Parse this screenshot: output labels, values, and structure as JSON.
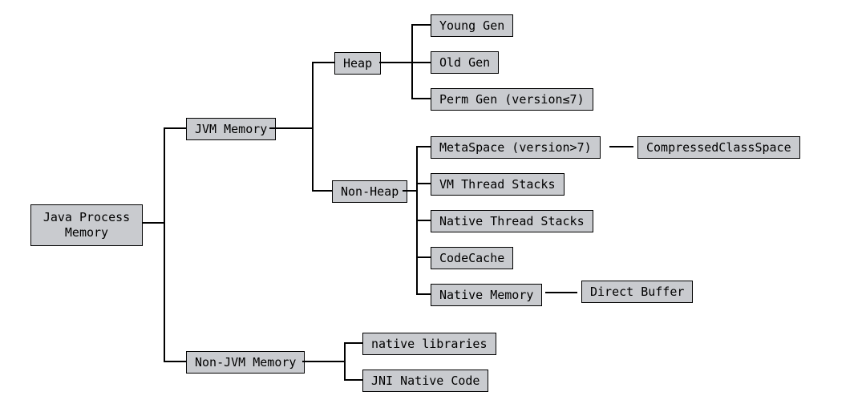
{
  "root": {
    "label": "Java Process\nMemory"
  },
  "l1": {
    "jvm": {
      "label": "JVM Memory"
    },
    "nonjvm": {
      "label": "Non-JVM Memory"
    }
  },
  "jvm_children": {
    "heap": {
      "label": "Heap"
    },
    "nonheap": {
      "label": "Non-Heap"
    }
  },
  "heap_children": {
    "young": {
      "label": "Young Gen"
    },
    "old": {
      "label": "Old Gen"
    },
    "perm": {
      "label": "Perm Gen (version≤7)"
    }
  },
  "nonheap_children": {
    "metaspace": {
      "label": "MetaSpace (version>7)"
    },
    "vmthread": {
      "label": "VM Thread Stacks"
    },
    "nativethread": {
      "label": "Native Thread Stacks"
    },
    "codecache": {
      "label": "CodeCache"
    },
    "nativemem": {
      "label": "Native Memory"
    }
  },
  "metaspace_child": {
    "label": "CompressedClassSpace"
  },
  "nativemem_child": {
    "label": "Direct Buffer"
  },
  "nonjvm_children": {
    "nativelibs": {
      "label": "native libraries"
    },
    "jni": {
      "label": "JNI Native Code"
    }
  },
  "chart_data": {
    "type": "tree",
    "title": "Java Process Memory breakdown",
    "root": {
      "name": "Java Process Memory",
      "children": [
        {
          "name": "JVM Memory",
          "children": [
            {
              "name": "Heap",
              "children": [
                {
                  "name": "Young Gen"
                },
                {
                  "name": "Old Gen"
                },
                {
                  "name": "Perm Gen (version≤7)"
                }
              ]
            },
            {
              "name": "Non-Heap",
              "children": [
                {
                  "name": "MetaSpace (version>7)",
                  "children": [
                    {
                      "name": "CompressedClassSpace"
                    }
                  ]
                },
                {
                  "name": "VM Thread Stacks"
                },
                {
                  "name": "Native Thread Stacks"
                },
                {
                  "name": "CodeCache"
                },
                {
                  "name": "Native Memory",
                  "children": [
                    {
                      "name": "Direct Buffer"
                    }
                  ]
                }
              ]
            }
          ]
        },
        {
          "name": "Non-JVM Memory",
          "children": [
            {
              "name": "native libraries"
            },
            {
              "name": "JNI Native Code"
            }
          ]
        }
      ]
    }
  }
}
